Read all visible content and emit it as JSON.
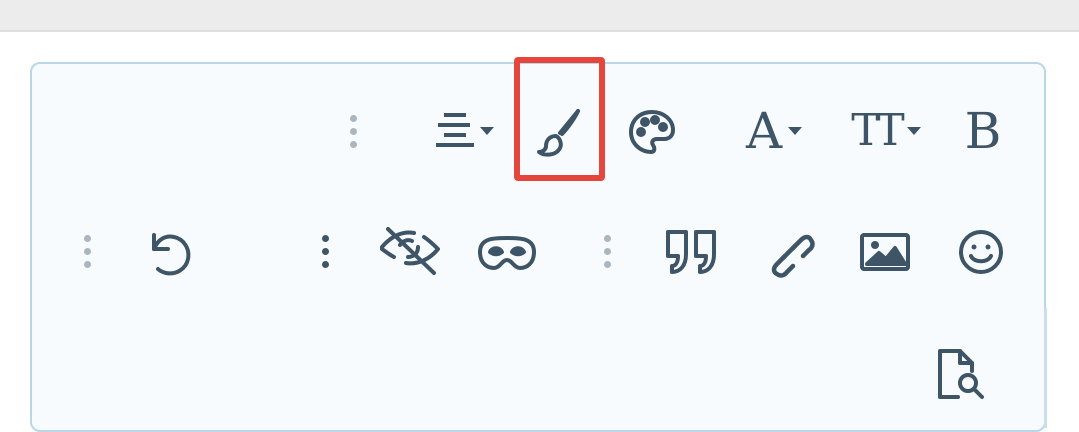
{
  "toolbar_row1": {
    "font_letter": "A",
    "font_size_letters": "TT",
    "bold_letter": "B"
  },
  "colors": {
    "icon": "#3d5566",
    "grip": "#a9b6bf",
    "border": "#b9d7e6",
    "highlight": "#e4463b",
    "background": "#f8fbfd"
  },
  "icons": [
    "grip-vertical-icon",
    "align-center-icon",
    "caret-down-icon",
    "brush-icon",
    "palette-icon",
    "font-icon",
    "text-size-icon",
    "bold-icon",
    "undo-icon",
    "more-vertical-icon",
    "eye-slash-icon",
    "mask-icon",
    "quote-icon",
    "link-icon",
    "image-icon",
    "smile-icon",
    "file-search-icon"
  ]
}
